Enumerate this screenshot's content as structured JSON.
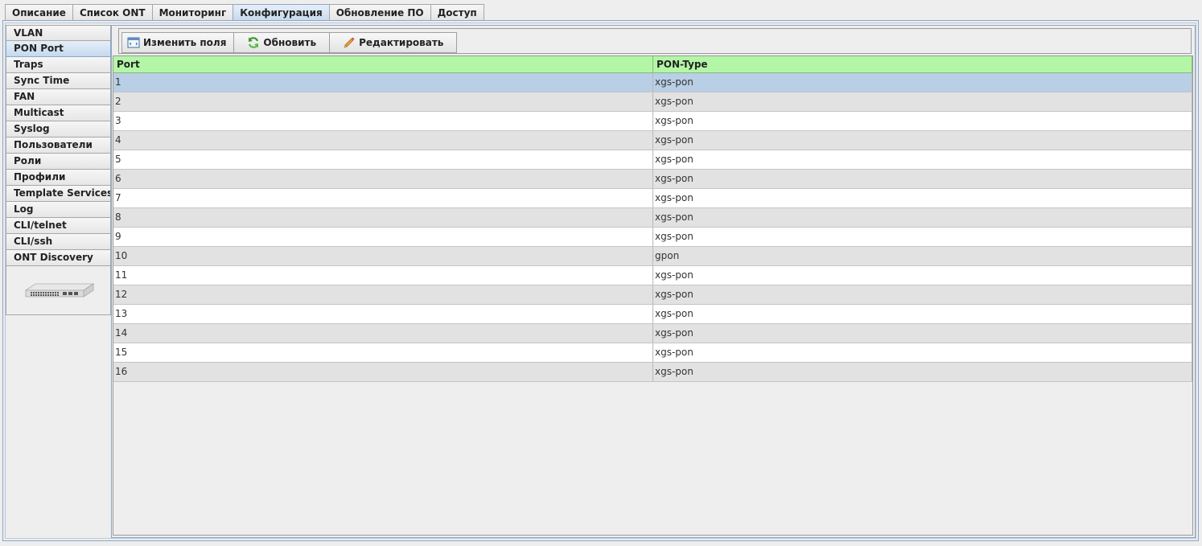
{
  "top_tabs": [
    {
      "label": "Описание"
    },
    {
      "label": "Список ONT"
    },
    {
      "label": "Мониторинг"
    },
    {
      "label": "Конфигурация",
      "active": true
    },
    {
      "label": "Обновление ПО"
    },
    {
      "label": "Доступ"
    }
  ],
  "side_tabs": [
    {
      "label": "VLAN"
    },
    {
      "label": "PON Port",
      "active": true
    },
    {
      "label": "Traps"
    },
    {
      "label": "Sync Time"
    },
    {
      "label": "FAN"
    },
    {
      "label": "Multicast"
    },
    {
      "label": "Syslog"
    },
    {
      "label": "Пользователи"
    },
    {
      "label": "Роли"
    },
    {
      "label": "Профили"
    },
    {
      "label": "Template Services"
    },
    {
      "label": "Log"
    },
    {
      "label": "CLI/telnet"
    },
    {
      "label": "CLI/ssh"
    },
    {
      "label": "ONT Discovery"
    }
  ],
  "toolbar": {
    "edit_fields_label": "Изменить поля",
    "refresh_label": "Обновить",
    "edit_label": "Редактировать"
  },
  "table": {
    "columns": [
      "Port",
      "PON-Type"
    ],
    "rows": [
      [
        "1",
        "xgs-pon"
      ],
      [
        "2",
        "xgs-pon"
      ],
      [
        "3",
        "xgs-pon"
      ],
      [
        "4",
        "xgs-pon"
      ],
      [
        "5",
        "xgs-pon"
      ],
      [
        "6",
        "xgs-pon"
      ],
      [
        "7",
        "xgs-pon"
      ],
      [
        "8",
        "xgs-pon"
      ],
      [
        "9",
        "xgs-pon"
      ],
      [
        "10",
        "gpon"
      ],
      [
        "11",
        "xgs-pon"
      ],
      [
        "12",
        "xgs-pon"
      ],
      [
        "13",
        "xgs-pon"
      ],
      [
        "14",
        "xgs-pon"
      ],
      [
        "15",
        "xgs-pon"
      ],
      [
        "16",
        "xgs-pon"
      ]
    ],
    "selected_row": 0
  },
  "colors": {
    "header_bg": "#b3f7a6",
    "selected_row": "#b8cfe5",
    "active_tab": "#c6d9ee"
  }
}
